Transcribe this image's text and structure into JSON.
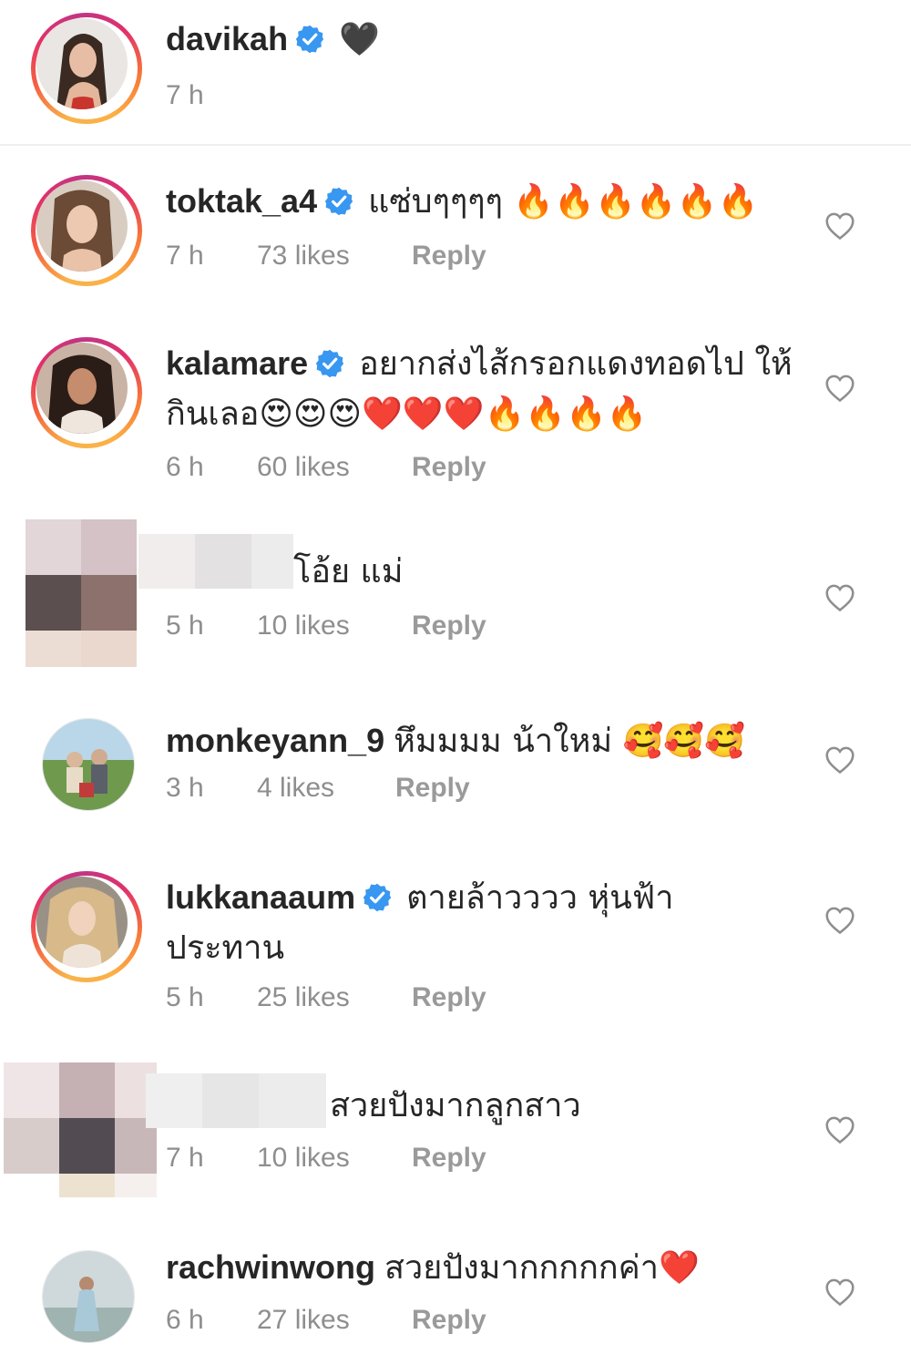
{
  "caption": {
    "username": "davikah",
    "verified": true,
    "text": "🖤",
    "time": "7 h"
  },
  "comments": [
    {
      "username": "toktak_a4",
      "verified": true,
      "text": "แซ่บๆๆๆๆ 🔥🔥🔥🔥🔥🔥",
      "time": "7 h",
      "likes": "73 likes",
      "reply": "Reply"
    },
    {
      "username": "kalamare",
      "verified": true,
      "text": "อยากส่งไส้กรอกแดงทอดไป ให้กินเลอ😍😍😍❤️❤️❤️🔥🔥🔥🔥",
      "time": "6 h",
      "likes": "60 likes",
      "reply": "Reply"
    },
    {
      "username": "",
      "verified": false,
      "text": "โอ้ย แม่",
      "time": "5 h",
      "likes": "10 likes",
      "reply": "Reply"
    },
    {
      "username": "monkeyann_9",
      "verified": false,
      "text": "หึมมมม  น้าใหม่ 🥰🥰🥰",
      "time": "3 h",
      "likes": "4 likes",
      "reply": "Reply"
    },
    {
      "username": "lukkanaaum",
      "verified": true,
      "text": "ตายล้าวววว หุ่นฟ้า ประทาน",
      "time": "5 h",
      "likes": "25 likes",
      "reply": "Reply"
    },
    {
      "username": "",
      "verified": false,
      "text": "สวยปังมากลูกสาว",
      "time": "7 h",
      "likes": "10 likes",
      "reply": "Reply"
    },
    {
      "username": "rachwinwong",
      "verified": false,
      "text": "สวยปังมากกกกกค่า❤️",
      "time": "6 h",
      "likes": "27 likes",
      "reply": "Reply"
    }
  ],
  "colors": {
    "verified": "#3897f0",
    "meta": "#8e8e8e",
    "text": "#262626"
  },
  "icons": {
    "verified": "verified-badge-icon",
    "like": "heart-outline-icon"
  }
}
